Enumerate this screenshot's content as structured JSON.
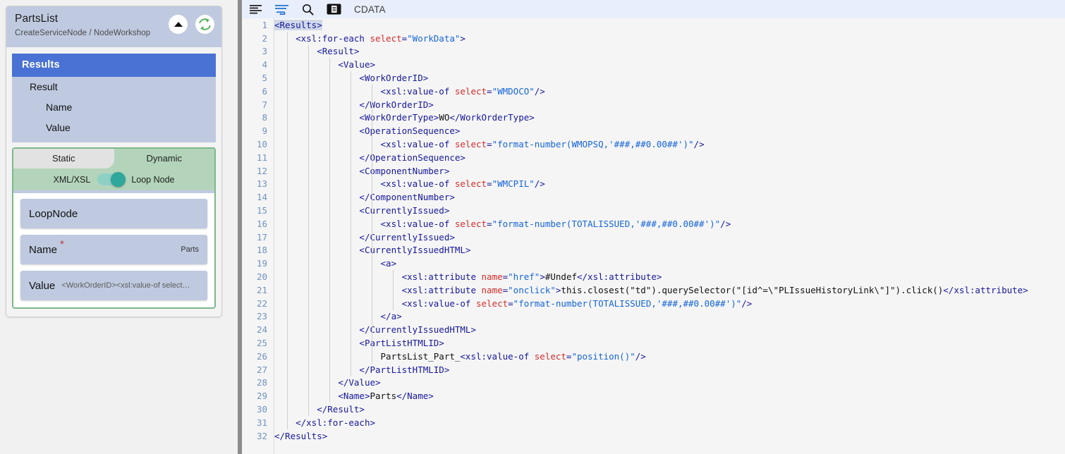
{
  "panel": {
    "title": "PartsList",
    "breadcrumb": "CreateServiceNode / NodeWorkshop",
    "collapse_icon": "triangle-up-icon",
    "refresh_icon": "refresh-sync-icon",
    "tree": {
      "header": "Results",
      "items": [
        {
          "label": "Result",
          "level": 1
        },
        {
          "label": "Name",
          "level": 2
        },
        {
          "label": "Value",
          "level": 2
        }
      ]
    },
    "tabs": [
      {
        "label": "Static",
        "active": false
      },
      {
        "label": "Dynamic",
        "active": true
      }
    ],
    "toggle": {
      "left_label": "XML/XSL",
      "right_label": "Loop Node",
      "state": "on"
    },
    "fields": [
      {
        "label": "LoopNode",
        "value": "",
        "required": false,
        "value_position": "none"
      },
      {
        "label": "Name",
        "value": "Parts",
        "required": true,
        "value_position": "right"
      },
      {
        "label": "Value",
        "value": "<WorkOrderID><xsl:value-of select…",
        "required": false,
        "value_position": "inline"
      }
    ]
  },
  "toolbar": {
    "items": [
      {
        "name": "format-align-icon",
        "label": ""
      },
      {
        "name": "word-wrap-icon",
        "label": ""
      },
      {
        "name": "search-icon",
        "label": ""
      },
      {
        "name": "cdata-block-icon",
        "label": ""
      }
    ],
    "cdata_label": "CDATA"
  },
  "editor": {
    "lines": [
      {
        "n": 1,
        "indent": 0,
        "html": "<span class='tag sel-tag'>&lt;Results&gt;</span>"
      },
      {
        "n": 2,
        "indent": 1,
        "html": "<span class='tag'>&lt;xsl:for-each </span><span class='attr'>select</span><span class='tag'>=</span><span class='val'>\"WorkData\"</span><span class='tag'>&gt;</span>"
      },
      {
        "n": 3,
        "indent": 2,
        "html": "<span class='tag'>&lt;Result&gt;</span>"
      },
      {
        "n": 4,
        "indent": 3,
        "html": "<span class='tag'>&lt;Value&gt;</span>"
      },
      {
        "n": 5,
        "indent": 4,
        "html": "<span class='tag'>&lt;WorkOrderID&gt;</span>"
      },
      {
        "n": 6,
        "indent": 5,
        "html": "<span class='tag'>&lt;xsl:value-of </span><span class='attr'>select</span><span class='tag'>=</span><span class='val'>\"WMDOCO\"</span><span class='tag'>/&gt;</span>"
      },
      {
        "n": 7,
        "indent": 4,
        "html": "<span class='tag'>&lt;/WorkOrderID&gt;</span>"
      },
      {
        "n": 8,
        "indent": 4,
        "html": "<span class='tag'>&lt;WorkOrderType&gt;</span><span class='txt'>WO</span><span class='tag'>&lt;/WorkOrderType&gt;</span>"
      },
      {
        "n": 9,
        "indent": 4,
        "html": "<span class='tag'>&lt;OperationSequence&gt;</span>"
      },
      {
        "n": 10,
        "indent": 5,
        "html": "<span class='tag'>&lt;xsl:value-of </span><span class='attr'>select</span><span class='tag'>=</span><span class='val'>\"format-number(WMOPSQ,'###,##0.00##')\"</span><span class='tag'>/&gt;</span>"
      },
      {
        "n": 11,
        "indent": 4,
        "html": "<span class='tag'>&lt;/OperationSequence&gt;</span>"
      },
      {
        "n": 12,
        "indent": 4,
        "html": "<span class='tag'>&lt;ComponentNumber&gt;</span>"
      },
      {
        "n": 13,
        "indent": 5,
        "html": "<span class='tag'>&lt;xsl:value-of </span><span class='attr'>select</span><span class='tag'>=</span><span class='val'>\"WMCPIL\"</span><span class='tag'>/&gt;</span>"
      },
      {
        "n": 14,
        "indent": 4,
        "html": "<span class='tag'>&lt;/ComponentNumber&gt;</span>"
      },
      {
        "n": 15,
        "indent": 4,
        "html": "<span class='tag'>&lt;CurrentlyIssued&gt;</span>"
      },
      {
        "n": 16,
        "indent": 5,
        "html": "<span class='tag'>&lt;xsl:value-of </span><span class='attr'>select</span><span class='tag'>=</span><span class='val'>\"format-number(TOTALISSUED,'###,##0.00##')\"</span><span class='tag'>/&gt;</span>"
      },
      {
        "n": 17,
        "indent": 4,
        "html": "<span class='tag'>&lt;/CurrentlyIssued&gt;</span>"
      },
      {
        "n": 18,
        "indent": 4,
        "html": "<span class='tag'>&lt;CurrentlyIssuedHTML&gt;</span>"
      },
      {
        "n": 19,
        "indent": 5,
        "html": "<span class='tag'>&lt;a&gt;</span>"
      },
      {
        "n": 20,
        "indent": 6,
        "html": "<span class='tag'>&lt;xsl:attribute </span><span class='attr'>name</span><span class='tag'>=</span><span class='val'>\"href\"</span><span class='tag'>&gt;</span><span class='txt'>#Undef</span><span class='tag'>&lt;/xsl:attribute&gt;</span>"
      },
      {
        "n": 21,
        "indent": 6,
        "html": "<span class='tag'>&lt;xsl:attribute </span><span class='attr'>name</span><span class='tag'>=</span><span class='val'>\"onclick\"</span><span class='tag'>&gt;</span><span class='txt'>this.closest(\"td\").querySelector(\"[id^=\\\"PLIssueHistoryLink\\\"]\").click()</span><span class='tag'>&lt;/xsl:attribute&gt;</span>"
      },
      {
        "n": 22,
        "indent": 6,
        "html": "<span class='tag'>&lt;xsl:value-of </span><span class='attr'>select</span><span class='tag'>=</span><span class='val'>\"format-number(TOTALISSUED,'###,##0.00##')\"</span><span class='tag'>/&gt;</span>"
      },
      {
        "n": 23,
        "indent": 5,
        "html": "<span class='tag'>&lt;/a&gt;</span>"
      },
      {
        "n": 24,
        "indent": 4,
        "html": "<span class='tag'>&lt;/CurrentlyIssuedHTML&gt;</span>"
      },
      {
        "n": 25,
        "indent": 4,
        "html": "<span class='tag'>&lt;PartListHTMLID&gt;</span>"
      },
      {
        "n": 26,
        "indent": 5,
        "html": "<span class='txt'>PartsList_Part_</span><span class='tag'>&lt;xsl:value-of </span><span class='attr'>select</span><span class='tag'>=</span><span class='val'>\"position()\"</span><span class='tag'>/&gt;</span>"
      },
      {
        "n": 27,
        "indent": 4,
        "html": "<span class='tag'>&lt;/PartListHTMLID&gt;</span>"
      },
      {
        "n": 28,
        "indent": 3,
        "html": "<span class='tag'>&lt;/Value&gt;</span>"
      },
      {
        "n": 29,
        "indent": 3,
        "html": "<span class='tag'>&lt;Name&gt;</span><span class='txt'>Parts</span><span class='tag'>&lt;/Name&gt;</span>"
      },
      {
        "n": 30,
        "indent": 2,
        "html": "<span class='tag'>&lt;/Result&gt;</span>"
      },
      {
        "n": 31,
        "indent": 1,
        "html": "<span class='tag'>&lt;/xsl:for-each&gt;</span>"
      },
      {
        "n": 32,
        "indent": 0,
        "html": "<span class='tag'>&lt;/Results&gt;</span>"
      }
    ]
  },
  "colors": {
    "panel_header_bg": "#bfcae0",
    "tree_header_bg": "#4a72d4",
    "tab_active_bg": "#b3d4bb",
    "toggle_on": "#2fa79b",
    "accent_refresh": "#4caf50",
    "tag": "#16179b",
    "attr": "#d42c2c",
    "value": "#1565d8"
  }
}
